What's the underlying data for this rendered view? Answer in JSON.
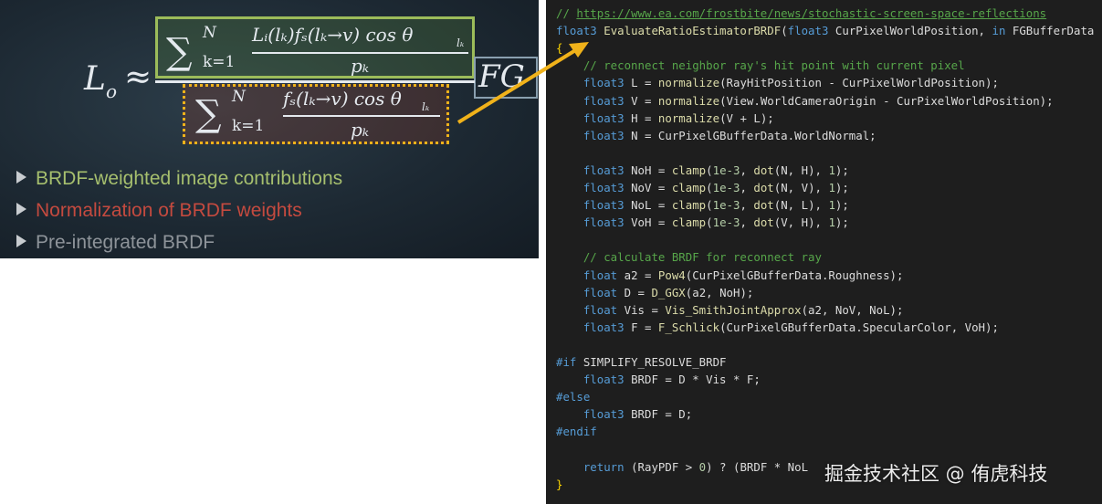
{
  "slide": {
    "lhs": "L",
    "lhs_sub": "o",
    "approx": "≈",
    "numerator": {
      "sum_upper": "N",
      "sum_lower": "k=1",
      "frac_top": "Lᵢ(lₖ)fₛ(lₖ→v) cos θ",
      "frac_top_sub": "lₖ",
      "frac_bottom": "pₖ"
    },
    "denominator": {
      "sum_upper": "N",
      "sum_lower": "k=1",
      "frac_top": "fₛ(lₖ→v) cos θ",
      "frac_top_sub": "lₖ",
      "frac_bottom": "pₖ"
    },
    "fg_label": "FG",
    "bullets": [
      {
        "text": "BRDF-weighted image contributions",
        "color": "#a6bf6e"
      },
      {
        "text": "Normalization of BRDF weights",
        "color": "#c44a3f"
      },
      {
        "text": "Pre-integrated BRDF",
        "color": "#8e949a"
      }
    ]
  },
  "code": {
    "lines": [
      [
        {
          "c": "c-com",
          "t": "// "
        },
        {
          "c": "c-link",
          "t": "https://www.ea.com/frostbite/news/stochastic-screen-space-reflections"
        }
      ],
      [
        {
          "c": "c-kw",
          "t": "float3"
        },
        {
          "c": "",
          "t": " "
        },
        {
          "c": "c-fn",
          "t": "EvaluateRatioEstimatorBRDF"
        },
        {
          "c": "",
          "t": "("
        },
        {
          "c": "c-kw",
          "t": "float3"
        },
        {
          "c": "",
          "t": " CurPixelWorldPosition, "
        },
        {
          "c": "c-kw",
          "t": "in"
        },
        {
          "c": "",
          "t": " FGBufferData"
        }
      ],
      [
        {
          "c": "c-br",
          "t": "{"
        }
      ],
      [
        {
          "c": "",
          "t": "    "
        },
        {
          "c": "c-com",
          "t": "// reconnect neighbor ray's hit point with current pixel"
        }
      ],
      [
        {
          "c": "",
          "t": "    "
        },
        {
          "c": "c-kw",
          "t": "float3"
        },
        {
          "c": "",
          "t": " L = "
        },
        {
          "c": "c-fn",
          "t": "normalize"
        },
        {
          "c": "",
          "t": "(RayHitPosition - CurPixelWorldPosition);"
        }
      ],
      [
        {
          "c": "",
          "t": "    "
        },
        {
          "c": "c-kw",
          "t": "float3"
        },
        {
          "c": "",
          "t": " V = "
        },
        {
          "c": "c-fn",
          "t": "normalize"
        },
        {
          "c": "",
          "t": "(View.WorldCameraOrigin - CurPixelWorldPosition);"
        }
      ],
      [
        {
          "c": "",
          "t": "    "
        },
        {
          "c": "c-kw",
          "t": "float3"
        },
        {
          "c": "",
          "t": " H = "
        },
        {
          "c": "c-fn",
          "t": "normalize"
        },
        {
          "c": "",
          "t": "(V + L);"
        }
      ],
      [
        {
          "c": "",
          "t": "    "
        },
        {
          "c": "c-kw",
          "t": "float3"
        },
        {
          "c": "",
          "t": " N = CurPixelGBufferData.WorldNormal;"
        }
      ],
      [],
      [
        {
          "c": "",
          "t": "    "
        },
        {
          "c": "c-kw",
          "t": "float3"
        },
        {
          "c": "",
          "t": " NoH = "
        },
        {
          "c": "c-fn",
          "t": "clamp"
        },
        {
          "c": "",
          "t": "("
        },
        {
          "c": "c-num",
          "t": "1e-3"
        },
        {
          "c": "",
          "t": ", "
        },
        {
          "c": "c-fn",
          "t": "dot"
        },
        {
          "c": "",
          "t": "(N, H), "
        },
        {
          "c": "c-num",
          "t": "1"
        },
        {
          "c": "",
          "t": ");"
        }
      ],
      [
        {
          "c": "",
          "t": "    "
        },
        {
          "c": "c-kw",
          "t": "float3"
        },
        {
          "c": "",
          "t": " NoV = "
        },
        {
          "c": "c-fn",
          "t": "clamp"
        },
        {
          "c": "",
          "t": "("
        },
        {
          "c": "c-num",
          "t": "1e-3"
        },
        {
          "c": "",
          "t": ", "
        },
        {
          "c": "c-fn",
          "t": "dot"
        },
        {
          "c": "",
          "t": "(N, V), "
        },
        {
          "c": "c-num",
          "t": "1"
        },
        {
          "c": "",
          "t": ");"
        }
      ],
      [
        {
          "c": "",
          "t": "    "
        },
        {
          "c": "c-kw",
          "t": "float3"
        },
        {
          "c": "",
          "t": " NoL = "
        },
        {
          "c": "c-fn",
          "t": "clamp"
        },
        {
          "c": "",
          "t": "("
        },
        {
          "c": "c-num",
          "t": "1e-3"
        },
        {
          "c": "",
          "t": ", "
        },
        {
          "c": "c-fn",
          "t": "dot"
        },
        {
          "c": "",
          "t": "(N, L), "
        },
        {
          "c": "c-num",
          "t": "1"
        },
        {
          "c": "",
          "t": ");"
        }
      ],
      [
        {
          "c": "",
          "t": "    "
        },
        {
          "c": "c-kw",
          "t": "float3"
        },
        {
          "c": "",
          "t": " VoH = "
        },
        {
          "c": "c-fn",
          "t": "clamp"
        },
        {
          "c": "",
          "t": "("
        },
        {
          "c": "c-num",
          "t": "1e-3"
        },
        {
          "c": "",
          "t": ", "
        },
        {
          "c": "c-fn",
          "t": "dot"
        },
        {
          "c": "",
          "t": "(V, H), "
        },
        {
          "c": "c-num",
          "t": "1"
        },
        {
          "c": "",
          "t": ");"
        }
      ],
      [],
      [
        {
          "c": "",
          "t": "    "
        },
        {
          "c": "c-com",
          "t": "// calculate BRDF for reconnect ray"
        }
      ],
      [
        {
          "c": "",
          "t": "    "
        },
        {
          "c": "c-kw",
          "t": "float"
        },
        {
          "c": "",
          "t": " a2 = "
        },
        {
          "c": "c-fn",
          "t": "Pow4"
        },
        {
          "c": "",
          "t": "(CurPixelGBufferData.Roughness);"
        }
      ],
      [
        {
          "c": "",
          "t": "    "
        },
        {
          "c": "c-kw",
          "t": "float"
        },
        {
          "c": "",
          "t": " D = "
        },
        {
          "c": "c-fn",
          "t": "D_GGX"
        },
        {
          "c": "",
          "t": "(a2, NoH);"
        }
      ],
      [
        {
          "c": "",
          "t": "    "
        },
        {
          "c": "c-kw",
          "t": "float"
        },
        {
          "c": "",
          "t": " Vis = "
        },
        {
          "c": "c-fn",
          "t": "Vis_SmithJointApprox"
        },
        {
          "c": "",
          "t": "(a2, NoV, NoL);"
        }
      ],
      [
        {
          "c": "",
          "t": "    "
        },
        {
          "c": "c-kw",
          "t": "float3"
        },
        {
          "c": "",
          "t": " F = "
        },
        {
          "c": "c-fn",
          "t": "F_Schlick"
        },
        {
          "c": "",
          "t": "(CurPixelGBufferData.SpecularColor, VoH);"
        }
      ],
      [],
      [
        {
          "c": "c-kw",
          "t": "#if"
        },
        {
          "c": "",
          "t": " SIMPLIFY_RESOLVE_BRDF"
        }
      ],
      [
        {
          "c": "",
          "t": "    "
        },
        {
          "c": "c-kw",
          "t": "float3"
        },
        {
          "c": "",
          "t": " BRDF = D * Vis * F;"
        }
      ],
      [
        {
          "c": "c-kw",
          "t": "#else"
        }
      ],
      [
        {
          "c": "",
          "t": "    "
        },
        {
          "c": "c-kw",
          "t": "float3"
        },
        {
          "c": "",
          "t": " BRDF = D;"
        }
      ],
      [
        {
          "c": "c-kw",
          "t": "#endif"
        }
      ],
      [],
      [
        {
          "c": "",
          "t": "    "
        },
        {
          "c": "c-kw",
          "t": "return"
        },
        {
          "c": "",
          "t": " (RayPDF > "
        },
        {
          "c": "c-num",
          "t": "0"
        },
        {
          "c": "",
          "t": ") ? (BRDF * NoL "
        }
      ],
      [
        {
          "c": "c-br",
          "t": "}"
        }
      ]
    ]
  },
  "watermark": "掘金技术社区 @ 侑虎科技",
  "colors": {
    "arrow": "#f0b21a",
    "code_bg": "#1e1e1e"
  }
}
